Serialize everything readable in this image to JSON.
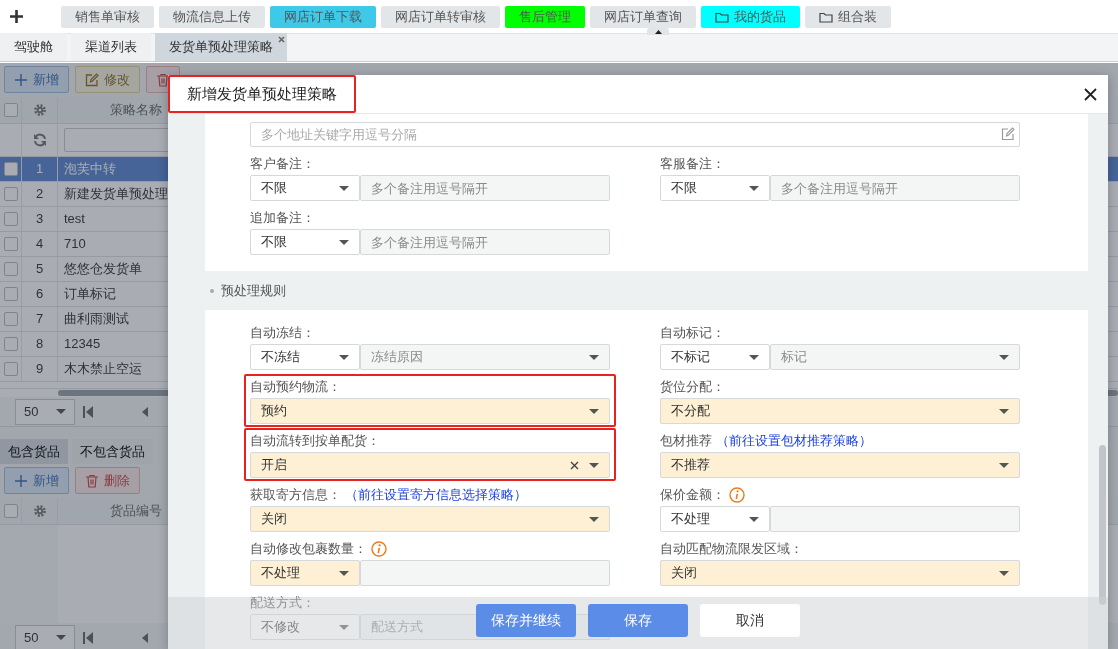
{
  "top_bar": {
    "tabs": [
      {
        "label": "销售单审核",
        "color": "#e3e6e9",
        "kind": "page"
      },
      {
        "label": "物流信息上传",
        "color": "#e3e6e9",
        "kind": "page"
      },
      {
        "label": "网店订单下载",
        "color": "#3fc9e9",
        "kind": "page"
      },
      {
        "label": "网店订单转审核",
        "color": "#e3e6e9",
        "kind": "page"
      },
      {
        "label": "售后管理",
        "color": "#00ff00",
        "kind": "page"
      },
      {
        "label": "网店订单查询",
        "color": "#e3e6e9",
        "kind": "page"
      },
      {
        "label": "我的货品",
        "color": "#00ffff",
        "kind": "folder"
      },
      {
        "label": "组合装",
        "color": "#e3e6e9",
        "kind": "folder"
      }
    ]
  },
  "page_tabs": [
    {
      "label": "驾驶舱",
      "selected": false
    },
    {
      "label": "渠道列表",
      "selected": false
    },
    {
      "label": "发货单预处理策略",
      "selected": true,
      "closable": true
    }
  ],
  "strategy_panel": {
    "select_all": false,
    "buttons": [
      {
        "label": "新增",
        "kind": "add"
      },
      {
        "label": "修改",
        "kind": "edit"
      },
      {
        "kind": "delete"
      }
    ],
    "columns": [
      "策略名称"
    ],
    "rows": [
      {
        "index": "1",
        "name": "泡芙中转",
        "selected": true
      },
      {
        "index": "2",
        "name": "新建发货单预处理",
        "selected": false
      },
      {
        "index": "3",
        "name": "test",
        "selected": false
      },
      {
        "index": "4",
        "name": "710",
        "selected": false
      },
      {
        "index": "5",
        "name": "悠悠仓发货单",
        "selected": false
      },
      {
        "index": "6",
        "name": "订单标记",
        "selected": false
      },
      {
        "index": "7",
        "name": "曲利雨测试",
        "selected": false
      },
      {
        "index": "8",
        "name": "12345",
        "selected": false
      },
      {
        "index": "9",
        "name": "木木禁止空运",
        "selected": false
      }
    ],
    "page_size": "50"
  },
  "goods_panel": {
    "select_all": false,
    "tabs": [
      {
        "label": "包含货品",
        "selected": true
      },
      {
        "label": "不包含货品",
        "selected": false
      }
    ],
    "buttons": [
      {
        "label": "新增",
        "kind": "add"
      },
      {
        "label": "删除",
        "kind": "delete"
      }
    ],
    "columns": [
      "货品编号"
    ],
    "page_size": "50"
  },
  "modal": {
    "title": "新增发货单预处理策略",
    "title_highlighted": true,
    "filter_section": {
      "address_placeholder": "多个地址关键字用逗号分隔",
      "fields": [
        {
          "label": "客户备注：",
          "kind": "select_input",
          "value": "不限",
          "placeholder": "多个备注用逗号隔开",
          "required": false
        },
        {
          "label": "客服备注：",
          "kind": "select_input",
          "value": "不限",
          "placeholder": "多个备注用逗号隔开",
          "required": false
        },
        {
          "label": "追加备注：",
          "kind": "select_input",
          "value": "不限",
          "placeholder": "多个备注用逗号隔开",
          "required": false
        }
      ]
    },
    "rule_section": {
      "title": "预处理规则",
      "fields": [
        {
          "label": "自动冻结：",
          "kind": "select_select",
          "value": "不冻结",
          "placeholder": "冻结原因",
          "required": false
        },
        {
          "label": "自动标记：",
          "kind": "select_select",
          "value": "不标记",
          "placeholder": "标记",
          "required": false
        },
        {
          "label": "自动预约物流：",
          "kind": "select",
          "value": "预约",
          "required": true,
          "highlighted": true
        },
        {
          "label": "货位分配：",
          "kind": "select",
          "value": "不分配",
          "required": true
        },
        {
          "label": "自动流转到按单配货：",
          "kind": "select",
          "value": "开启",
          "required": true,
          "highlighted": true,
          "clearable": true
        },
        {
          "label": "包材推荐",
          "link": "（前往设置包材推荐策略）",
          "kind": "select",
          "value": "不推荐",
          "required": true
        },
        {
          "label": "获取寄方信息：",
          "link": "（前往设置寄方信息选择策略）",
          "kind": "select",
          "value": "关闭",
          "required": true
        },
        {
          "label": "保价金额：",
          "info": true,
          "kind": "select_input",
          "value": "不处理",
          "required": false
        },
        {
          "label": "自动修改包裹数量：",
          "info": true,
          "kind": "select_input",
          "value": "不处理",
          "required": true
        },
        {
          "label": "自动匹配物流限发区域：",
          "kind": "select",
          "value": "关闭",
          "required": true
        },
        {
          "label": "配送方式：",
          "kind": "select_select",
          "value": "不修改",
          "placeholder": "配送方式"
        }
      ]
    },
    "buttons": [
      {
        "label": "保存并继续",
        "kind": "primary"
      },
      {
        "label": "保存",
        "kind": "primary"
      },
      {
        "label": "取消",
        "kind": "default"
      }
    ]
  }
}
